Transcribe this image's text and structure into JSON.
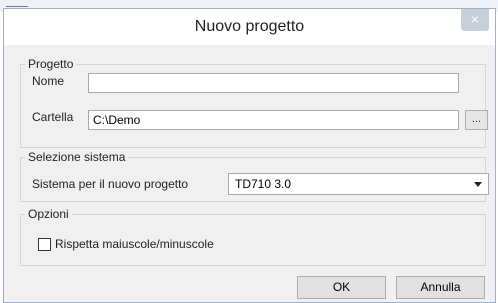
{
  "dialog": {
    "title": "Nuovo progetto",
    "close_glyph": "×"
  },
  "progetto": {
    "group_label": "Progetto",
    "nome_label": "Nome",
    "nome_value": "",
    "cartella_label": "Cartella",
    "cartella_value": "C:\\Demo",
    "browse_label": "..."
  },
  "sistema": {
    "group_label": "Selezione sistema",
    "label": "Sistema per il nuovo progetto",
    "selected": "TD710 3.0"
  },
  "opzioni": {
    "group_label": "Opzioni",
    "checkbox_label": "Rispetta maiuscole/minuscole",
    "checked": false
  },
  "buttons": {
    "ok": "OK",
    "cancel": "Annulla"
  }
}
